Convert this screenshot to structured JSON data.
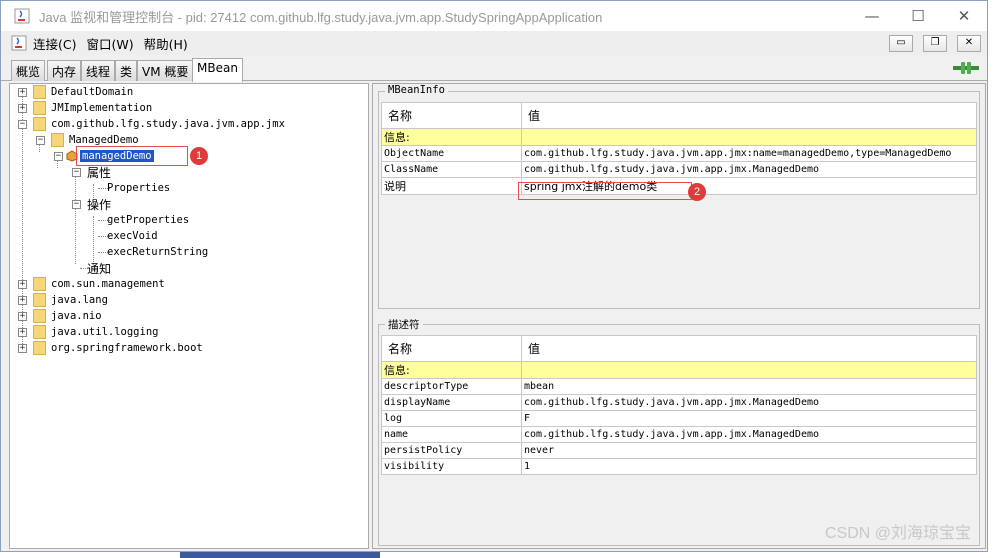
{
  "window": {
    "title": "Java 监视和管理控制台 - pid: 27412 com.github.lfg.study.java.jvm.app.StudySpringAppApplication",
    "controls": {
      "minimize": "—",
      "maximize": "☐",
      "close": "✕"
    }
  },
  "menubar": {
    "items": [
      "连接(C)",
      "窗口(W)",
      "帮助(H)"
    ],
    "inner_buttons": {
      "minimize": "▭",
      "restore": "❐",
      "close": "✕"
    }
  },
  "tabs": [
    "概览",
    "内存",
    "线程",
    "类",
    "VM 概要",
    "MBean"
  ],
  "active_tab": "MBean",
  "tree": {
    "domains_top": [
      "DefaultDomain",
      "JMImplementation",
      "com.github.lfg.study.java.jvm.app.jmx"
    ],
    "type_node": "ManagedDemo",
    "bean_node": "managedDemo",
    "attributes_label": "属性",
    "attributes": [
      "Properties"
    ],
    "operations_label": "操作",
    "operations": [
      "getProperties",
      "execVoid",
      "execReturnString"
    ],
    "notifications_label": "通知",
    "domains_bottom": [
      "com.sun.management",
      "java.lang",
      "java.nio",
      "java.util.logging",
      "org.springframework.boot"
    ]
  },
  "annotations": {
    "badge1": "1",
    "badge2": "2"
  },
  "mbean_info": {
    "title": "MBeanInfo",
    "headers": [
      "名称",
      "值"
    ],
    "info_label": "信息:",
    "rows": [
      {
        "name": "ObjectName",
        "value": "com.github.lfg.study.java.jvm.app.jmx:name=managedDemo,type=ManagedDemo"
      },
      {
        "name": "ClassName",
        "value": "com.github.lfg.study.java.jvm.app.jmx.ManagedDemo"
      },
      {
        "name": "说明",
        "value": "spring jmx注解的demo类"
      }
    ]
  },
  "descriptor": {
    "title": "描述符",
    "headers": [
      "名称",
      "值"
    ],
    "info_label": "信息:",
    "rows": [
      {
        "name": "descriptorType",
        "value": "mbean"
      },
      {
        "name": "displayName",
        "value": "com.github.lfg.study.java.jvm.app.jmx.ManagedDemo"
      },
      {
        "name": "log",
        "value": "F"
      },
      {
        "name": "name",
        "value": "com.github.lfg.study.java.jvm.app.jmx.ManagedDemo"
      },
      {
        "name": "persistPolicy",
        "value": "never"
      },
      {
        "name": "visibility",
        "value": "1"
      }
    ]
  },
  "watermark": "CSDN @刘海琼宝宝",
  "colors": {
    "selection": "#1f57c8",
    "info_row": "#ffff9c",
    "folder": "#f5d77a",
    "annotation_red": "#e03a3a"
  }
}
